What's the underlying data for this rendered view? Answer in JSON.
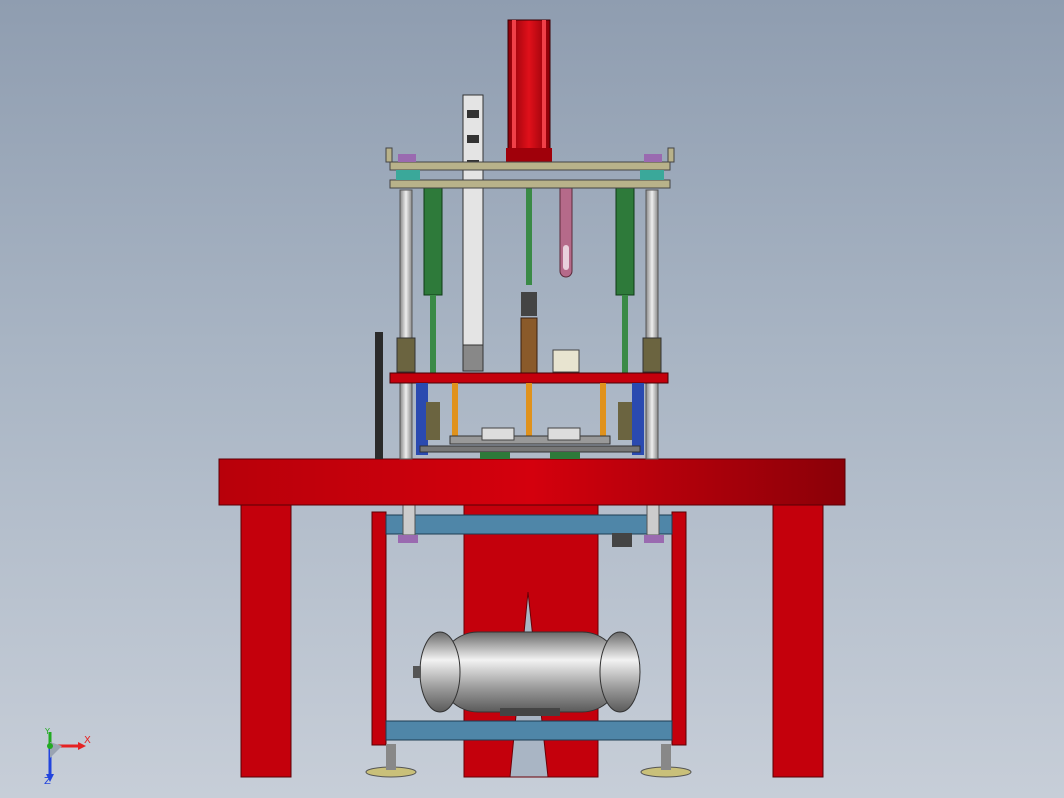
{
  "viewport": {
    "background_top": "#8f9db0",
    "background_bottom": "#c7ced8"
  },
  "colors": {
    "frame_red": "#c4000c",
    "frame_red_dark": "#8a0008",
    "steel_blue": "#4f86a8",
    "plate_khaki": "#b8b28a",
    "cylinder_green": "#2e7a3a",
    "rod_orange": "#e0921c",
    "tank_silver": "#bfbfbf",
    "bushing_olive": "#6b6440",
    "handle_pink": "#b56a8a",
    "axis_red": "#e52222",
    "axis_green": "#22aa22",
    "axis_blue": "#2244dd"
  },
  "triad": {
    "x_label": "X",
    "y_label": "Y",
    "z_label": "Z",
    "icon": "coordinate-triad-icon"
  }
}
